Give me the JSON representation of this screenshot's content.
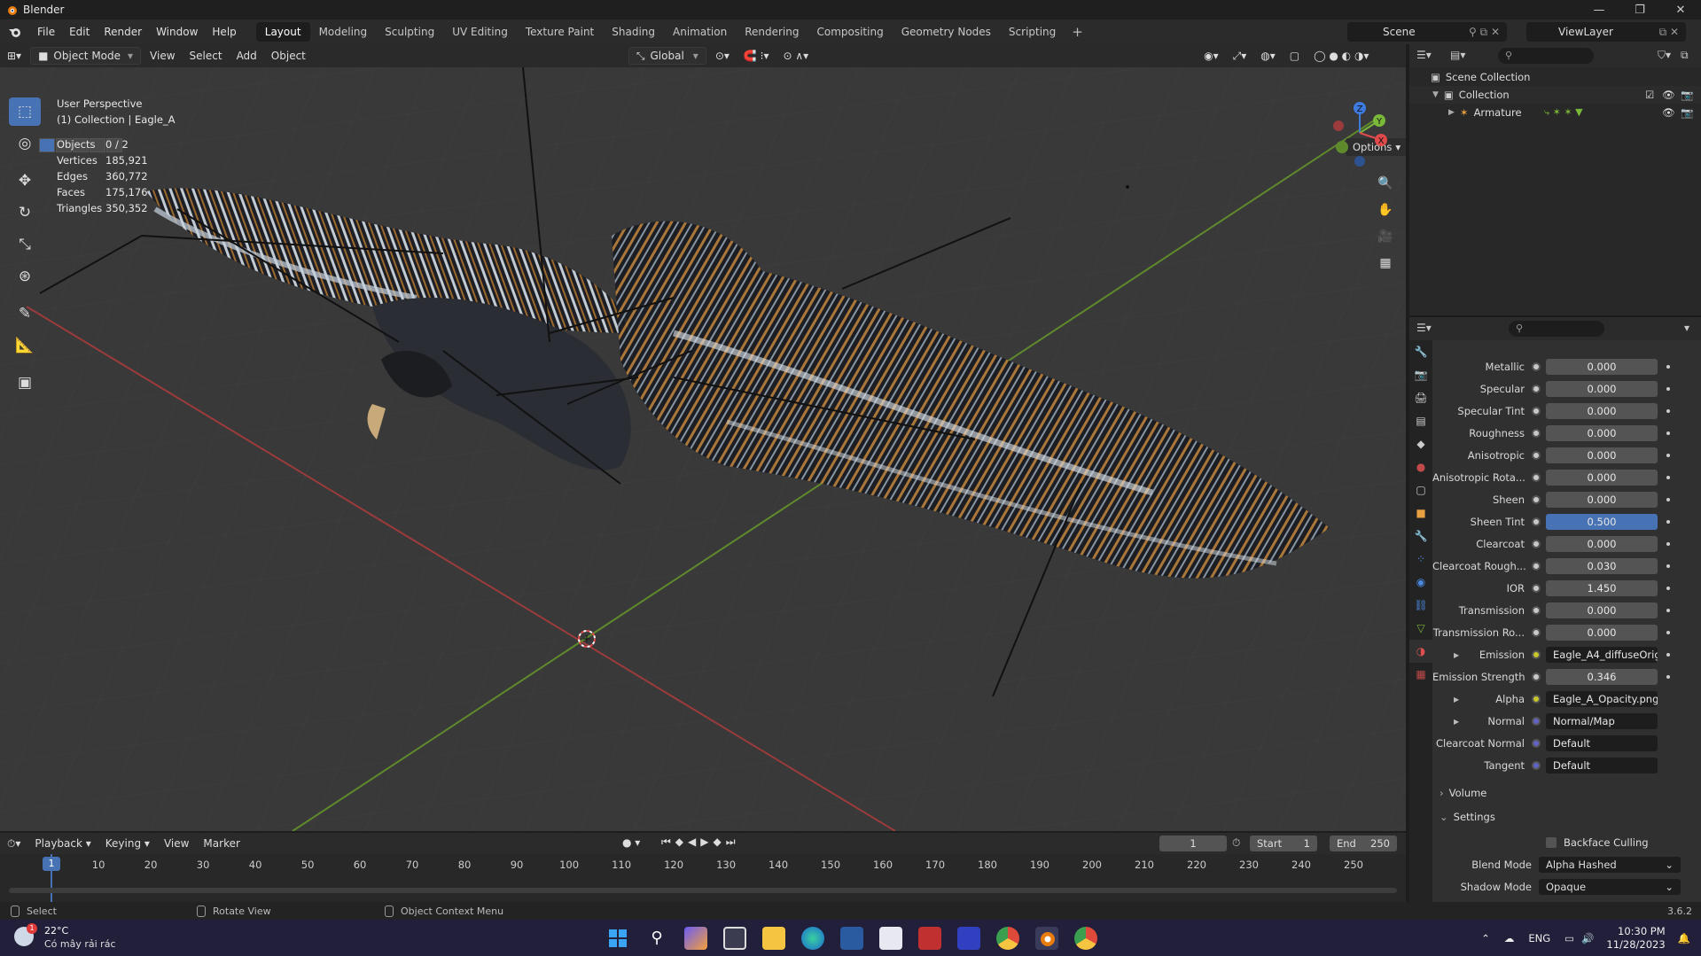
{
  "window": {
    "title": "Blender",
    "minimize": "—",
    "maximize": "❐",
    "close": "✕"
  },
  "menu": {
    "items": [
      "File",
      "Edit",
      "Render",
      "Window",
      "Help"
    ],
    "workspaces": [
      "Layout",
      "Modeling",
      "Sculpting",
      "UV Editing",
      "Texture Paint",
      "Shading",
      "Animation",
      "Rendering",
      "Compositing",
      "Geometry Nodes",
      "Scripting"
    ],
    "active_workspace": "Layout",
    "add_workspace": "+",
    "scene": "Scene",
    "view_layer": "ViewLayer"
  },
  "viewport_header": {
    "mode": "Object Mode",
    "menus": [
      "View",
      "Select",
      "Add",
      "Object"
    ],
    "orientation": "Global",
    "options": "Options"
  },
  "viewport": {
    "view_name": "User Perspective",
    "collection_info": "(1) Collection | Eagle_A",
    "stats": [
      {
        "label": "Objects",
        "value": "0 / 2"
      },
      {
        "label": "Vertices",
        "value": "185,921"
      },
      {
        "label": "Edges",
        "value": "360,772"
      },
      {
        "label": "Faces",
        "value": "175,176"
      },
      {
        "label": "Triangles",
        "value": "350,352"
      }
    ],
    "gizmo_axes": [
      "Z",
      "Y",
      "X"
    ]
  },
  "outliner": {
    "rows": [
      {
        "label": "Scene Collection"
      },
      {
        "label": "Collection"
      },
      {
        "label": "Armature"
      }
    ]
  },
  "properties": {
    "rows": [
      {
        "label": "Metallic",
        "value": "0.000",
        "kind": "num"
      },
      {
        "label": "Specular",
        "value": "0.000",
        "kind": "num"
      },
      {
        "label": "Specular Tint",
        "value": "0.000",
        "kind": "num"
      },
      {
        "label": "Roughness",
        "value": "0.000",
        "kind": "num"
      },
      {
        "label": "Anisotropic",
        "value": "0.000",
        "kind": "num"
      },
      {
        "label": "Anisotropic Rota...",
        "value": "0.000",
        "kind": "num"
      },
      {
        "label": "Sheen",
        "value": "0.000",
        "kind": "num"
      },
      {
        "label": "Sheen Tint",
        "value": "0.500",
        "kind": "sel"
      },
      {
        "label": "Clearcoat",
        "value": "0.000",
        "kind": "num"
      },
      {
        "label": "Clearcoat Rough...",
        "value": "0.030",
        "kind": "num"
      },
      {
        "label": "IOR",
        "value": "1.450",
        "kind": "num"
      },
      {
        "label": "Transmission",
        "value": "0.000",
        "kind": "num"
      },
      {
        "label": "Transmission Ro...",
        "value": "0.000",
        "kind": "num"
      },
      {
        "label": "Emission",
        "value": "Eagle_A4_diffuseOrigin...",
        "kind": "tex"
      },
      {
        "label": "Emission Strength",
        "value": "0.346",
        "kind": "num"
      },
      {
        "label": "Alpha",
        "value": "Eagle_A_Opacity.png",
        "kind": "tex"
      },
      {
        "label": "Normal",
        "value": "Normal/Map",
        "kind": "link"
      },
      {
        "label": "Clearcoat Normal",
        "value": "Default",
        "kind": "link"
      },
      {
        "label": "Tangent",
        "value": "Default",
        "kind": "link"
      }
    ],
    "panels": {
      "volume": "Volume",
      "settings": "Settings"
    },
    "backface_culling": "Backface Culling",
    "blend_mode_label": "Blend Mode",
    "blend_mode_value": "Alpha Hashed",
    "shadow_mode_label": "Shadow Mode",
    "shadow_mode_value": "Opaque"
  },
  "timeline": {
    "menus": [
      "Playback",
      "Keying",
      "View",
      "Marker"
    ],
    "current_frame": "1",
    "start_label": "Start",
    "start": "1",
    "end_label": "End",
    "end": "250",
    "ticks": [
      "1",
      "10",
      "20",
      "30",
      "40",
      "50",
      "60",
      "70",
      "80",
      "90",
      "100",
      "110",
      "120",
      "130",
      "140",
      "150",
      "160",
      "170",
      "180",
      "190",
      "200",
      "210",
      "220",
      "230",
      "240",
      "250"
    ]
  },
  "statusbar": {
    "select": "Select",
    "rotate": "Rotate View",
    "context": "Object Context Menu",
    "version": "3.6.2"
  },
  "taskbar": {
    "weather_temp": "22°C",
    "weather_desc": "Có mây rải rác",
    "weather_badge": "1",
    "lang": "ENG",
    "time": "10:30 PM",
    "date": "11/28/2023"
  },
  "colors": {
    "accent": "#4772b3",
    "x_axis": "#e04a4a",
    "y_axis": "#7ab83a",
    "z_axis": "#3e7be0",
    "viewport_bg": "#393939"
  }
}
